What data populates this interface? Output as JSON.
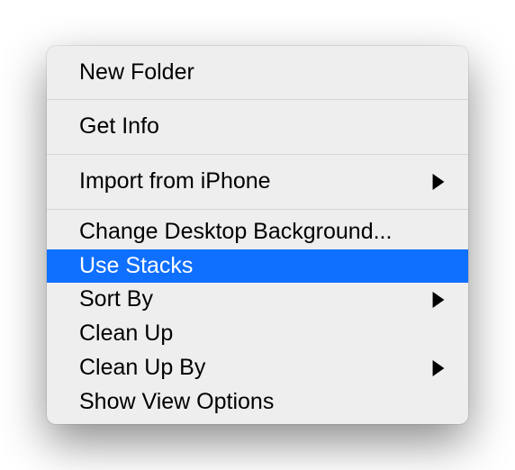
{
  "menu": {
    "items": {
      "new_folder": {
        "label": "New Folder"
      },
      "get_info": {
        "label": "Get Info"
      },
      "import_from_iphone": {
        "label": "Import from iPhone",
        "has_submenu": true
      },
      "change_desktop_bg": {
        "label": "Change Desktop Background..."
      },
      "use_stacks": {
        "label": "Use Stacks",
        "highlighted": true
      },
      "sort_by": {
        "label": "Sort By",
        "has_submenu": true
      },
      "clean_up": {
        "label": "Clean Up"
      },
      "clean_up_by": {
        "label": "Clean Up By",
        "has_submenu": true
      },
      "show_view_options": {
        "label": "Show View Options"
      }
    }
  }
}
